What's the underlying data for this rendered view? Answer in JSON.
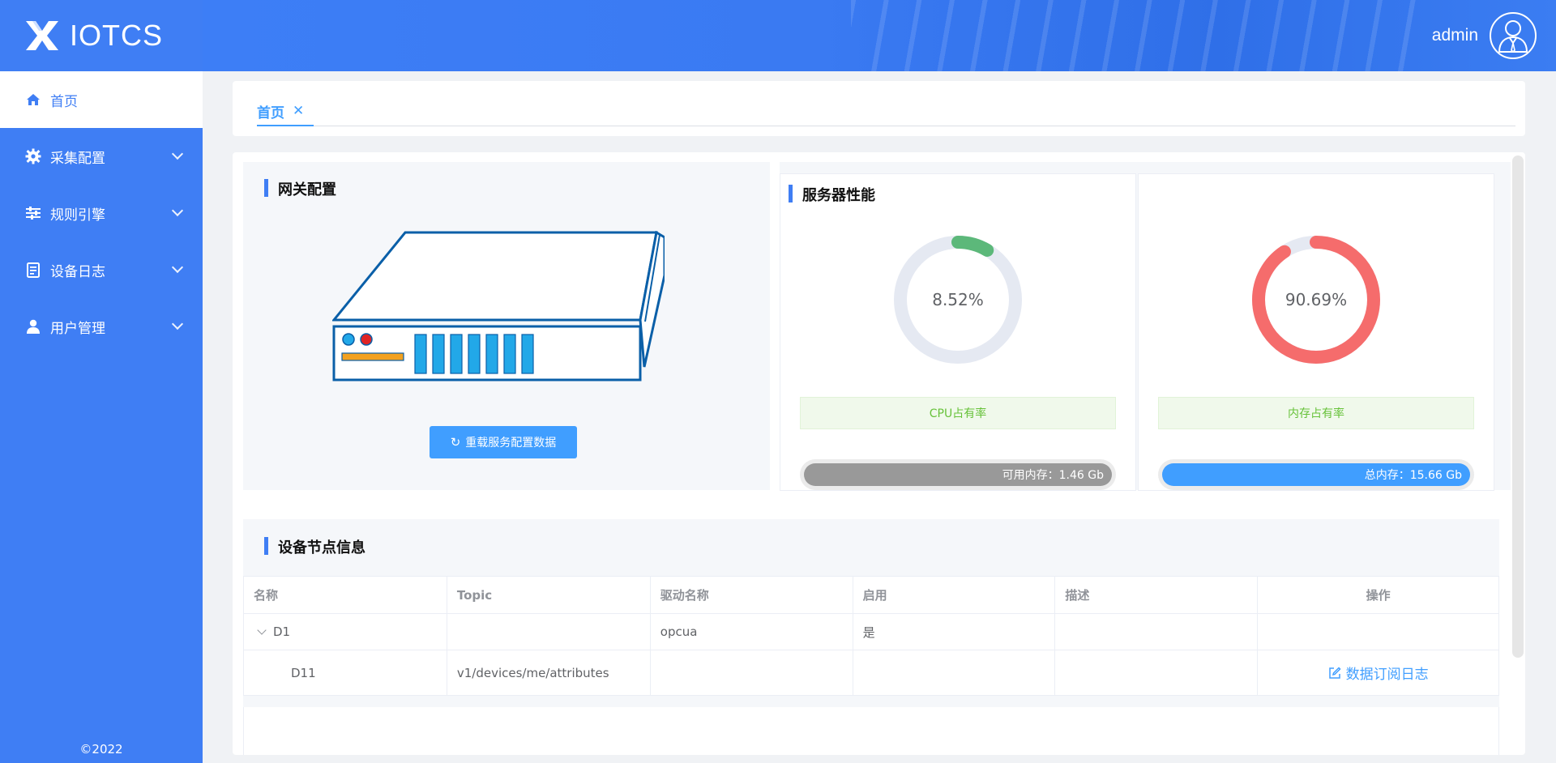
{
  "app": {
    "name": "IOTCS",
    "copyright": "©2022"
  },
  "header": {
    "username": "admin"
  },
  "sidebar": {
    "items": [
      {
        "label": "首页",
        "icon": "home-icon",
        "active": true
      },
      {
        "label": "采集配置",
        "icon": "gear-icon"
      },
      {
        "label": "规则引擎",
        "icon": "sliders-icon"
      },
      {
        "label": "设备日志",
        "icon": "document-icon"
      },
      {
        "label": "用户管理",
        "icon": "user-icon"
      }
    ]
  },
  "tabs": [
    {
      "label": "首页",
      "close": "✕"
    }
  ],
  "gateway": {
    "title": "网关配置",
    "reload_label": "重载服务配置数据"
  },
  "performance": {
    "title": "服务器性能",
    "cpu": {
      "value_text": "8.52%",
      "percent": 8.52,
      "color": "#5cb87a",
      "label": "CPU占有率",
      "progress_text": "可用内存：1.46 Gb",
      "progress_color": "#999999"
    },
    "memory": {
      "value_text": "90.69%",
      "percent": 90.69,
      "color": "#f56c6c",
      "label": "内存占有率",
      "progress_text": "总内存：15.66 Gb",
      "progress_color": "#409eff"
    }
  },
  "nodes": {
    "title": "设备节点信息",
    "columns": [
      "名称",
      "Topic",
      "驱动名称",
      "启用",
      "描述",
      "操作"
    ],
    "rows": [
      {
        "name": "D1",
        "topic": "",
        "driver": "opcua",
        "enabled": "是",
        "desc": "",
        "action": ""
      },
      {
        "name": "D11",
        "topic": "v1/devices/me/attributes",
        "driver": "",
        "enabled": "",
        "desc": "",
        "action": "数据订阅日志"
      }
    ]
  }
}
